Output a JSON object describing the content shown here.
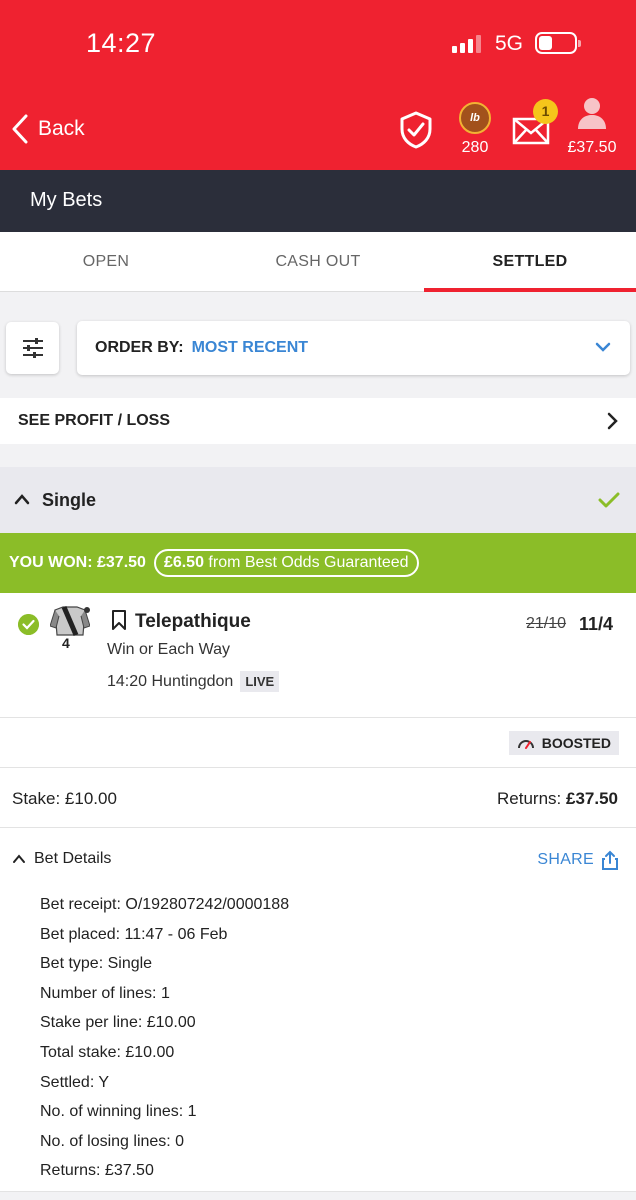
{
  "status_bar": {
    "time": "14:27",
    "network": "5G"
  },
  "header": {
    "back_label": "Back",
    "loyalty_logo": "lb",
    "loyalty_points": "280",
    "mail_badge": "1",
    "balance": "£37.50",
    "icons": [
      "shield-check-icon",
      "loyalty-coin-icon",
      "mail-icon",
      "account-icon"
    ]
  },
  "title": "My Bets",
  "tabs": [
    {
      "label": "OPEN"
    },
    {
      "label": "CASH OUT"
    },
    {
      "label": "SETTLED",
      "active": true
    }
  ],
  "order": {
    "label": "ORDER BY:",
    "value": "MOST RECENT"
  },
  "profit_loss_label": "SEE PROFIT / LOSS",
  "bet": {
    "type_header": "Single",
    "won_label": "YOU WON: £37.50",
    "bog_amount": "£6.50",
    "bog_text": " from Best Odds Guaranteed",
    "selection": {
      "cloth_number": "4",
      "horse": "Telepathique",
      "market": "Win or Each Way",
      "race": "14:20 Huntingdon",
      "live_badge": "LIVE",
      "old_odds": "21/10",
      "new_odds": "11/4"
    },
    "boost_label": "BOOSTED",
    "stake": "Stake: £10.00",
    "returns_label": "Returns: ",
    "returns_value": "£37.50",
    "details_label": "Bet Details",
    "share_label": "SHARE",
    "details": [
      "Bet receipt: O/192807242/0000188",
      "Bet placed: 11:47 - 06 Feb",
      "Bet type: Single",
      "Number of lines: 1",
      "Stake per line: £10.00",
      "Total stake: £10.00",
      "Settled: Y",
      "No. of winning lines: 1",
      "No. of losing lines: 0",
      "Returns: £37.50"
    ]
  },
  "colors": {
    "brand_red": "#ef2230",
    "win_green": "#8bbd28",
    "link_blue": "#3a86d4",
    "dark_bar": "#2b2e3a"
  }
}
